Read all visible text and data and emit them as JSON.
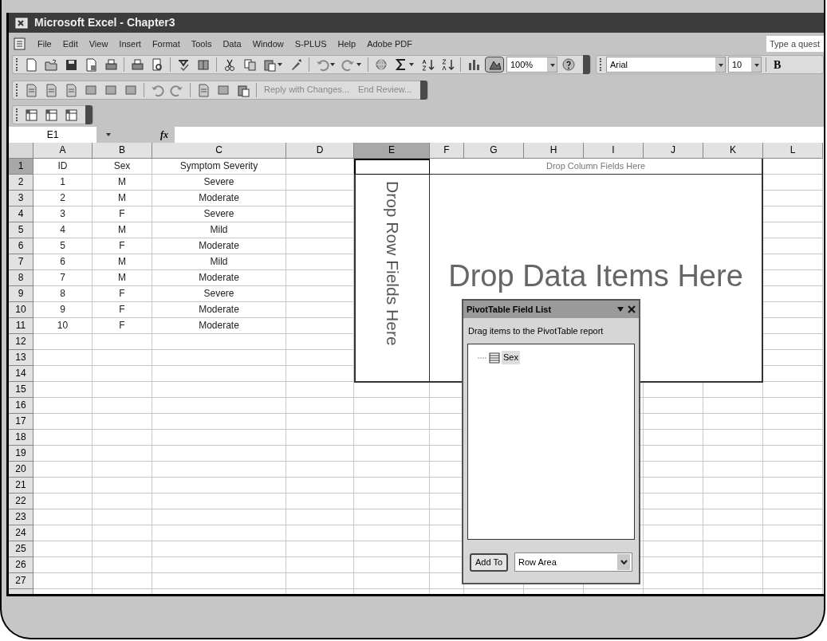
{
  "window": {
    "title": "Microsoft Excel - Chapter3"
  },
  "menu": [
    "File",
    "Edit",
    "View",
    "Insert",
    "Format",
    "Tools",
    "Data",
    "Window",
    "S-PLUS",
    "Help",
    "Adobe PDF"
  ],
  "help_search": {
    "placeholder": "Type a quest"
  },
  "standard_toolbar": {
    "zoom": "100%"
  },
  "formatting_toolbar": {
    "font": "Arial",
    "size": "10",
    "bold": "B"
  },
  "reviewing_toolbar": {
    "buttons": [
      {
        "label": "Reply with Changes...",
        "disabled": true
      },
      {
        "label": "End Review...",
        "disabled": true
      }
    ]
  },
  "formula_bar": {
    "name_box": "E1",
    "function_label": "fx"
  },
  "sheet": {
    "columns": [
      {
        "label": "A",
        "selected": false
      },
      {
        "label": "B",
        "selected": false
      },
      {
        "label": "C",
        "selected": false
      },
      {
        "label": "D",
        "selected": false
      },
      {
        "label": "E",
        "selected": true
      },
      {
        "label": "F",
        "selected": false
      },
      {
        "label": "G",
        "selected": false
      },
      {
        "label": "H",
        "selected": false
      },
      {
        "label": "I",
        "selected": false
      },
      {
        "label": "J",
        "selected": false
      },
      {
        "label": "K",
        "selected": false
      },
      {
        "label": "L",
        "selected": false
      }
    ],
    "rows": [
      {
        "label": "1",
        "selected": true,
        "cells": [
          "ID",
          "Sex",
          "Symptom Severity"
        ]
      },
      {
        "label": "2",
        "selected": false,
        "cells": [
          "1",
          "M",
          "Severe"
        ]
      },
      {
        "label": "3",
        "selected": false,
        "cells": [
          "2",
          "M",
          "Moderate"
        ]
      },
      {
        "label": "4",
        "selected": false,
        "cells": [
          "3",
          "F",
          "Severe"
        ]
      },
      {
        "label": "5",
        "selected": false,
        "cells": [
          "4",
          "M",
          "Mild"
        ]
      },
      {
        "label": "6",
        "selected": false,
        "cells": [
          "5",
          "F",
          "Moderate"
        ]
      },
      {
        "label": "7",
        "selected": false,
        "cells": [
          "6",
          "M",
          "Mild"
        ]
      },
      {
        "label": "8",
        "selected": false,
        "cells": [
          "7",
          "M",
          "Moderate"
        ]
      },
      {
        "label": "9",
        "selected": false,
        "cells": [
          "8",
          "F",
          "Severe"
        ]
      },
      {
        "label": "10",
        "selected": false,
        "cells": [
          "9",
          "F",
          "Moderate"
        ]
      },
      {
        "label": "11",
        "selected": false,
        "cells": [
          "10",
          "F",
          "Moderate"
        ]
      },
      {
        "label": "12",
        "selected": false
      },
      {
        "label": "13",
        "selected": false
      },
      {
        "label": "14",
        "selected": false
      },
      {
        "label": "15",
        "selected": false
      },
      {
        "label": "16",
        "selected": false
      },
      {
        "label": "17",
        "selected": false
      },
      {
        "label": "18",
        "selected": false
      },
      {
        "label": "19",
        "selected": false
      },
      {
        "label": "20",
        "selected": false
      },
      {
        "label": "21",
        "selected": false
      },
      {
        "label": "22",
        "selected": false
      },
      {
        "label": "23",
        "selected": false
      },
      {
        "label": "24",
        "selected": false
      },
      {
        "label": "25",
        "selected": false
      },
      {
        "label": "26",
        "selected": false
      },
      {
        "label": "27",
        "selected": false
      }
    ]
  },
  "pivot": {
    "column_area": "Drop Column Fields Here",
    "row_area": "Drop Row Fields Here",
    "data_area": "Drop Data Items Here"
  },
  "field_list": {
    "title": "PivotTable Field List",
    "instruction": "Drag items to the PivotTable report",
    "fields": [
      {
        "label": "Sex",
        "selected": true
      }
    ],
    "add_button": "Add To",
    "area": "Row Area"
  }
}
